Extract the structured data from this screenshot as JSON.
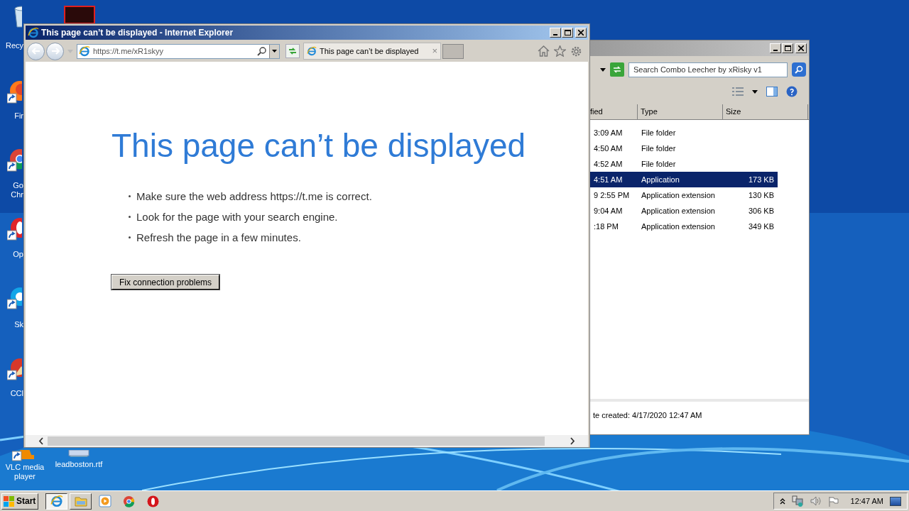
{
  "desktop_icons": [
    {
      "kind": "recycle",
      "label": "Recy"
    },
    {
      "kind": "firefox",
      "label": "Fir"
    },
    {
      "kind": "chrome",
      "label": "Go Chr"
    },
    {
      "kind": "opera",
      "label": "Op"
    },
    {
      "kind": "skype",
      "label": "Sk"
    },
    {
      "kind": "ccleaner",
      "label": "CCl"
    },
    {
      "kind": "vlc",
      "label": "VLC media player"
    },
    {
      "kind": "document",
      "label": "leadboston.rtf"
    }
  ],
  "ie": {
    "title": "This page can’t be displayed - Internet Explorer",
    "address": "https://t.me/xR1skyy",
    "tab": "This page can’t be displayed",
    "tab_close": "×",
    "heading": "This page can’t be displayed",
    "bullets": [
      "Make sure the web address https://t.me is correct.",
      "Look for the page with your search engine.",
      "Refresh the page in a few minutes."
    ],
    "button": "Fix connection problems"
  },
  "explorer": {
    "search_placeholder": "Search Combo Leecher by xRisky v1",
    "columns": [
      "fied",
      "Type",
      "Size"
    ],
    "rows": [
      {
        "modified": "3:09 AM",
        "type": "File folder",
        "size": null,
        "selected": false
      },
      {
        "modified": "4:50 AM",
        "type": "File folder",
        "size": null,
        "selected": false
      },
      {
        "modified": "4:52 AM",
        "type": "File folder",
        "size": null,
        "selected": false
      },
      {
        "modified": "4:51 AM",
        "type": "Application",
        "size": "173 KB",
        "selected": true
      },
      {
        "modified": "9 2:55 PM",
        "type": "Application extension",
        "size": "130 KB",
        "selected": false
      },
      {
        "modified": "9:04 AM",
        "type": "Application extension",
        "size": "306 KB",
        "selected": false
      },
      {
        "modified": ":18 PM",
        "type": "Application extension",
        "size": "349 KB",
        "selected": false
      }
    ],
    "details": "te created: 4/17/2020 12:47 AM"
  },
  "taskbar": {
    "start": "Start",
    "apps": [
      {
        "kind": "ie",
        "selected": true
      },
      {
        "kind": "explorer",
        "selected": false
      },
      {
        "kind": "media",
        "selected": false
      },
      {
        "kind": "chrome",
        "selected": false
      },
      {
        "kind": "opera",
        "selected": false
      }
    ],
    "clock": "12:47 AM"
  }
}
